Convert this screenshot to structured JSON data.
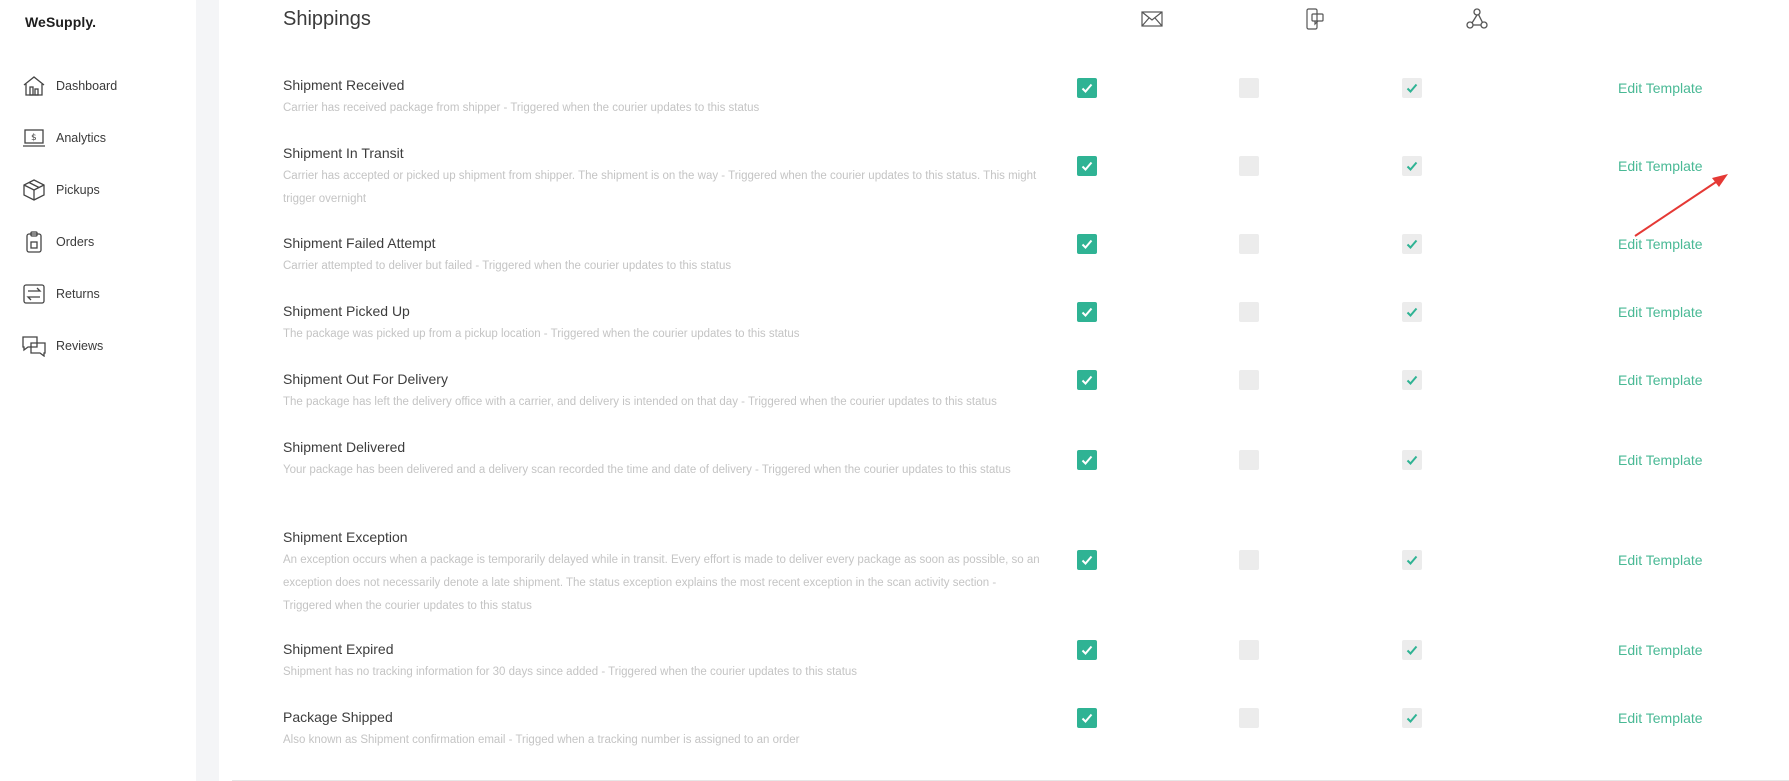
{
  "app": {
    "logo": "WeSupply."
  },
  "sidebar": {
    "items": [
      {
        "label": "Dashboard",
        "icon": "dashboard-icon"
      },
      {
        "label": "Analytics",
        "icon": "analytics-icon"
      },
      {
        "label": "Pickups",
        "icon": "box-icon"
      },
      {
        "label": "Orders",
        "icon": "clipboard-icon"
      },
      {
        "label": "Returns",
        "icon": "returns-icon"
      },
      {
        "label": "Reviews",
        "icon": "chat-icon"
      }
    ]
  },
  "main": {
    "title": "Shippings",
    "columns": [
      "email-icon",
      "sms-icon",
      "webhook-icon"
    ],
    "edit_label": "Edit Template",
    "colors": {
      "accent": "#2fb394",
      "link": "#49b995",
      "disabled": "#ececec",
      "arrow": "#e53935"
    },
    "rows": [
      {
        "title": "Shipment Received",
        "desc": "Carrier has received package from shipper - Triggered when the courier updates to this status",
        "email": true,
        "sms": false,
        "webhook": true
      },
      {
        "title": "Shipment In Transit",
        "desc": "Carrier has accepted or picked up shipment from shipper. The shipment is on the way - Triggered when the courier updates to this status. This might trigger overnight",
        "email": true,
        "sms": false,
        "webhook": true
      },
      {
        "title": "Shipment Failed Attempt",
        "desc": "Carrier attempted to deliver but failed - Triggered when the courier updates to this status",
        "email": true,
        "sms": false,
        "webhook": true
      },
      {
        "title": "Shipment Picked Up",
        "desc": "The package was picked up from a pickup location - Triggered when the courier updates to this status",
        "email": true,
        "sms": false,
        "webhook": true
      },
      {
        "title": "Shipment Out For Delivery",
        "desc": "The package has left the delivery office with a carrier, and delivery is intended on that day - Triggered when the courier updates to this status",
        "email": true,
        "sms": false,
        "webhook": true
      },
      {
        "title": "Shipment Delivered",
        "desc": "Your package has been delivered and a delivery scan recorded the time and date of delivery - Triggered when the courier updates to this status",
        "email": true,
        "sms": false,
        "webhook": true
      },
      {
        "title": "Shipment Exception",
        "desc": "An exception occurs when a package is temporarily delayed while in transit. Every effort is made to deliver every package as soon as possible, so an exception does not necessarily denote a late shipment. The status exception explains the most recent exception in the scan activity section - Triggered when the courier updates to this status",
        "email": true,
        "sms": false,
        "webhook": true
      },
      {
        "title": "Shipment Expired",
        "desc": "Shipment has no tracking information for 30 days since added - Triggered when the courier updates to this status",
        "email": true,
        "sms": false,
        "webhook": true
      },
      {
        "title": "Package Shipped",
        "desc": "Also known as Shipment confirmation email - Trigged when a tracking number is assigned to an order",
        "email": true,
        "sms": false,
        "webhook": true
      }
    ]
  }
}
